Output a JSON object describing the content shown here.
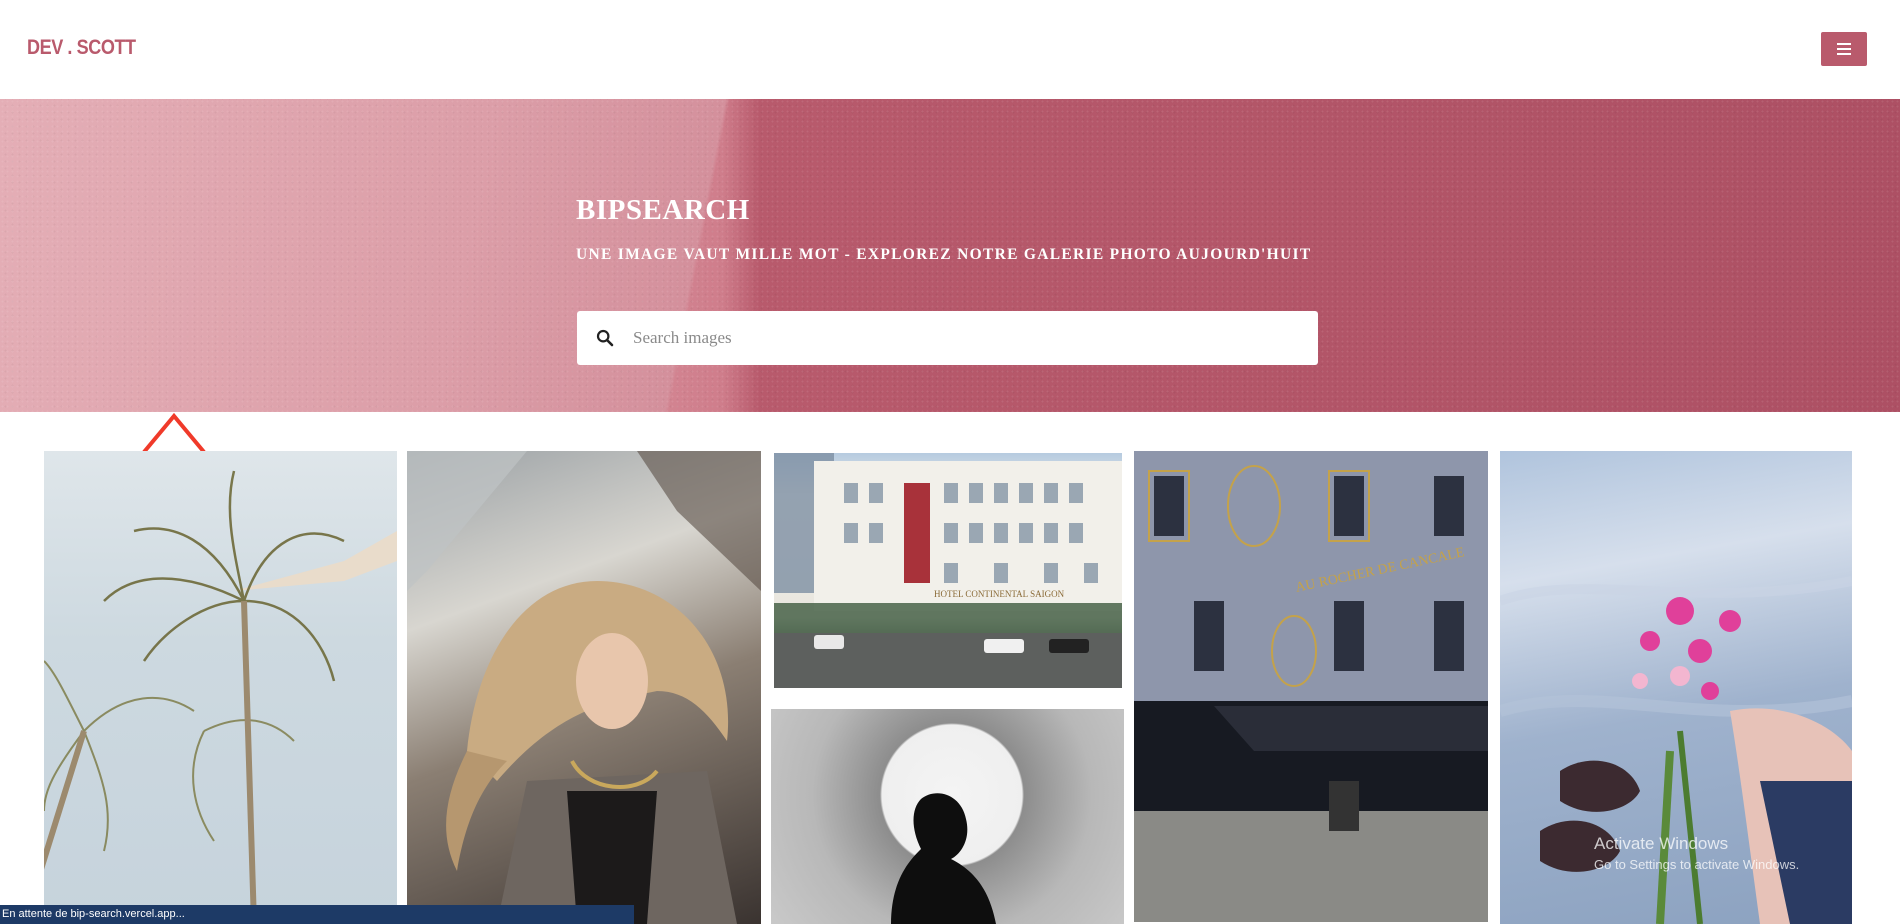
{
  "header": {
    "brand": "DEV . SCOTT",
    "menu_icon": "hamburger-menu-icon"
  },
  "hero": {
    "title": "BIPSEARCH",
    "subtitle": "UNE IMAGE VAUT MILLE MOT - EXPLOREZ NOTRE GALERIE PHOTO AUJOURD'HUIT",
    "search": {
      "icon": "search-icon",
      "placeholder": "Search images",
      "value": ""
    }
  },
  "gallery": {
    "images": [
      {
        "subject": "palm trees against sky"
      },
      {
        "subject": "woman with flowing hair"
      },
      {
        "subject": "hotel continental building"
      },
      {
        "subject": "woman silhouette with moon"
      },
      {
        "subject": "au rocher de cancale building"
      },
      {
        "subject": "hand holding pink flowers"
      }
    ],
    "signs": {
      "hotel": "HOTEL CONTINENTAL SAIGON",
      "building": "AU ROCHER DE CANCALE"
    }
  },
  "status_bar": {
    "text": "En attente de bip-search.vercel.app..."
  },
  "watermark": {
    "title": "Activate Windows",
    "subtitle": "Go to Settings to activate Windows."
  },
  "colors": {
    "brand": "#b95a6c",
    "hero_light": "#e3a6ae",
    "hero_dark": "#ad5064",
    "status_bar": "#1d3a66"
  }
}
